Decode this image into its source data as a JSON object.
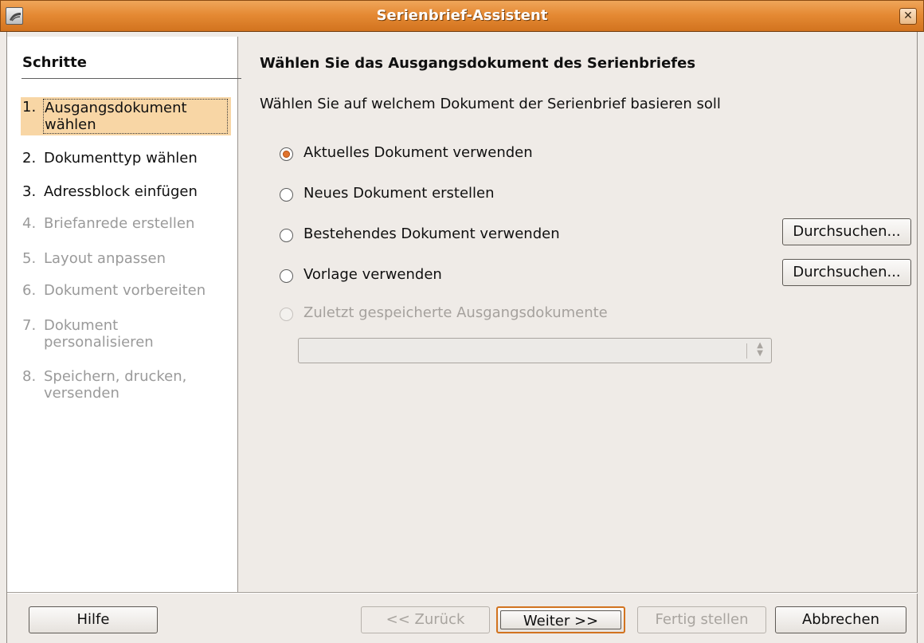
{
  "window": {
    "title": "Serienbrief-Assistent",
    "close_icon": "close-icon",
    "close_glyph": "✕"
  },
  "roadmap": {
    "title": "Schritte",
    "steps": [
      {
        "num": "1.",
        "label": "Ausgangsdokument wählen",
        "state": "active"
      },
      {
        "num": "2.",
        "label": "Dokumenttyp wählen",
        "state": "enabled"
      },
      {
        "num": "3.",
        "label": "Adressblock einfügen",
        "state": "enabled"
      },
      {
        "num": "4.",
        "label": "Briefanrede erstellen",
        "state": "disabled"
      },
      {
        "num": "5.",
        "label": "Layout anpassen",
        "state": "disabled"
      },
      {
        "num": "6.",
        "label": "Dokument vorbereiten",
        "state": "disabled"
      },
      {
        "num": "7.",
        "label": "Dokument personalisieren",
        "state": "disabled"
      },
      {
        "num": "8.",
        "label": "Speichern, drucken, versenden",
        "state": "disabled"
      }
    ]
  },
  "content": {
    "heading": "Wählen Sie das Ausgangsdokument des Serienbriefes",
    "description": "Wählen Sie auf welchem Dokument der Serienbrief basieren soll",
    "options": [
      {
        "label": "Aktuelles Dokument verwenden",
        "checked": true,
        "enabled": true
      },
      {
        "label": "Neues Dokument erstellen",
        "checked": false,
        "enabled": true
      },
      {
        "label": "Bestehendes Dokument verwenden",
        "checked": false,
        "enabled": true
      },
      {
        "label": "Vorlage verwenden",
        "checked": false,
        "enabled": true
      },
      {
        "label": "Zuletzt gespeicherte Ausgangsdokumente",
        "checked": false,
        "enabled": false
      }
    ],
    "browse_label": "Durchsuchen...",
    "recent_combo_value": ""
  },
  "buttons": {
    "help": "Hilfe",
    "back": "<< Zurück",
    "next": "Weiter >>",
    "finish": "Fertig stellen",
    "cancel": "Abbrechen"
  },
  "colors": {
    "titlebar": "#e58a34",
    "active_step": "#f8d6a5",
    "radio_dot": "#e0732d",
    "disabled_text": "#9a9a9a"
  }
}
